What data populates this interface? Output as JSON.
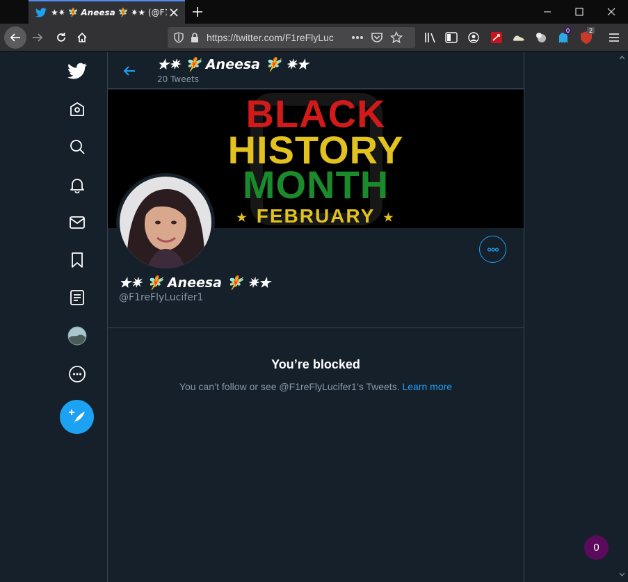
{
  "browser": {
    "tab": {
      "title": "★✷ 🧚 𝘼𝙣𝙚𝙚𝙨𝙖 🧚 ✷★ (@F1"
    },
    "url": "https://twitter.com/F1reFlyLuc",
    "toolbar_badges": {
      "ghostery": "0",
      "ublock": "2"
    }
  },
  "profile_header": {
    "name": "★✷ 🧚 𝘼𝙣𝙚𝙚𝙨𝙖 🧚 ✷★",
    "tweet_count": "20 Tweets"
  },
  "banner": {
    "line1": "BLACK",
    "line2": "HISTORY",
    "line3": "MONTH",
    "line4": "FEBRUARY",
    "colors": {
      "red": "#d21a1a",
      "yellow": "#e2c21e",
      "green": "#1a8a2c"
    }
  },
  "profile": {
    "name": "★✷ 🧚 𝘼𝙣𝙚𝙚𝙨𝙖 🧚 ✷★",
    "handle": "@F1reFlyLucifer1"
  },
  "blocked": {
    "title": "You’re blocked",
    "message": "You can’t follow or see @F1reFlyLucifer1’s Tweets.",
    "link": "Learn more"
  },
  "float_badge": "0",
  "icons": [
    "twitter-logo-icon",
    "home-icon",
    "search-icon",
    "bell-icon",
    "mail-icon",
    "bookmark-icon",
    "list-icon",
    "avatar",
    "more-icon",
    "compose-icon"
  ],
  "accent": "#1da1f2"
}
